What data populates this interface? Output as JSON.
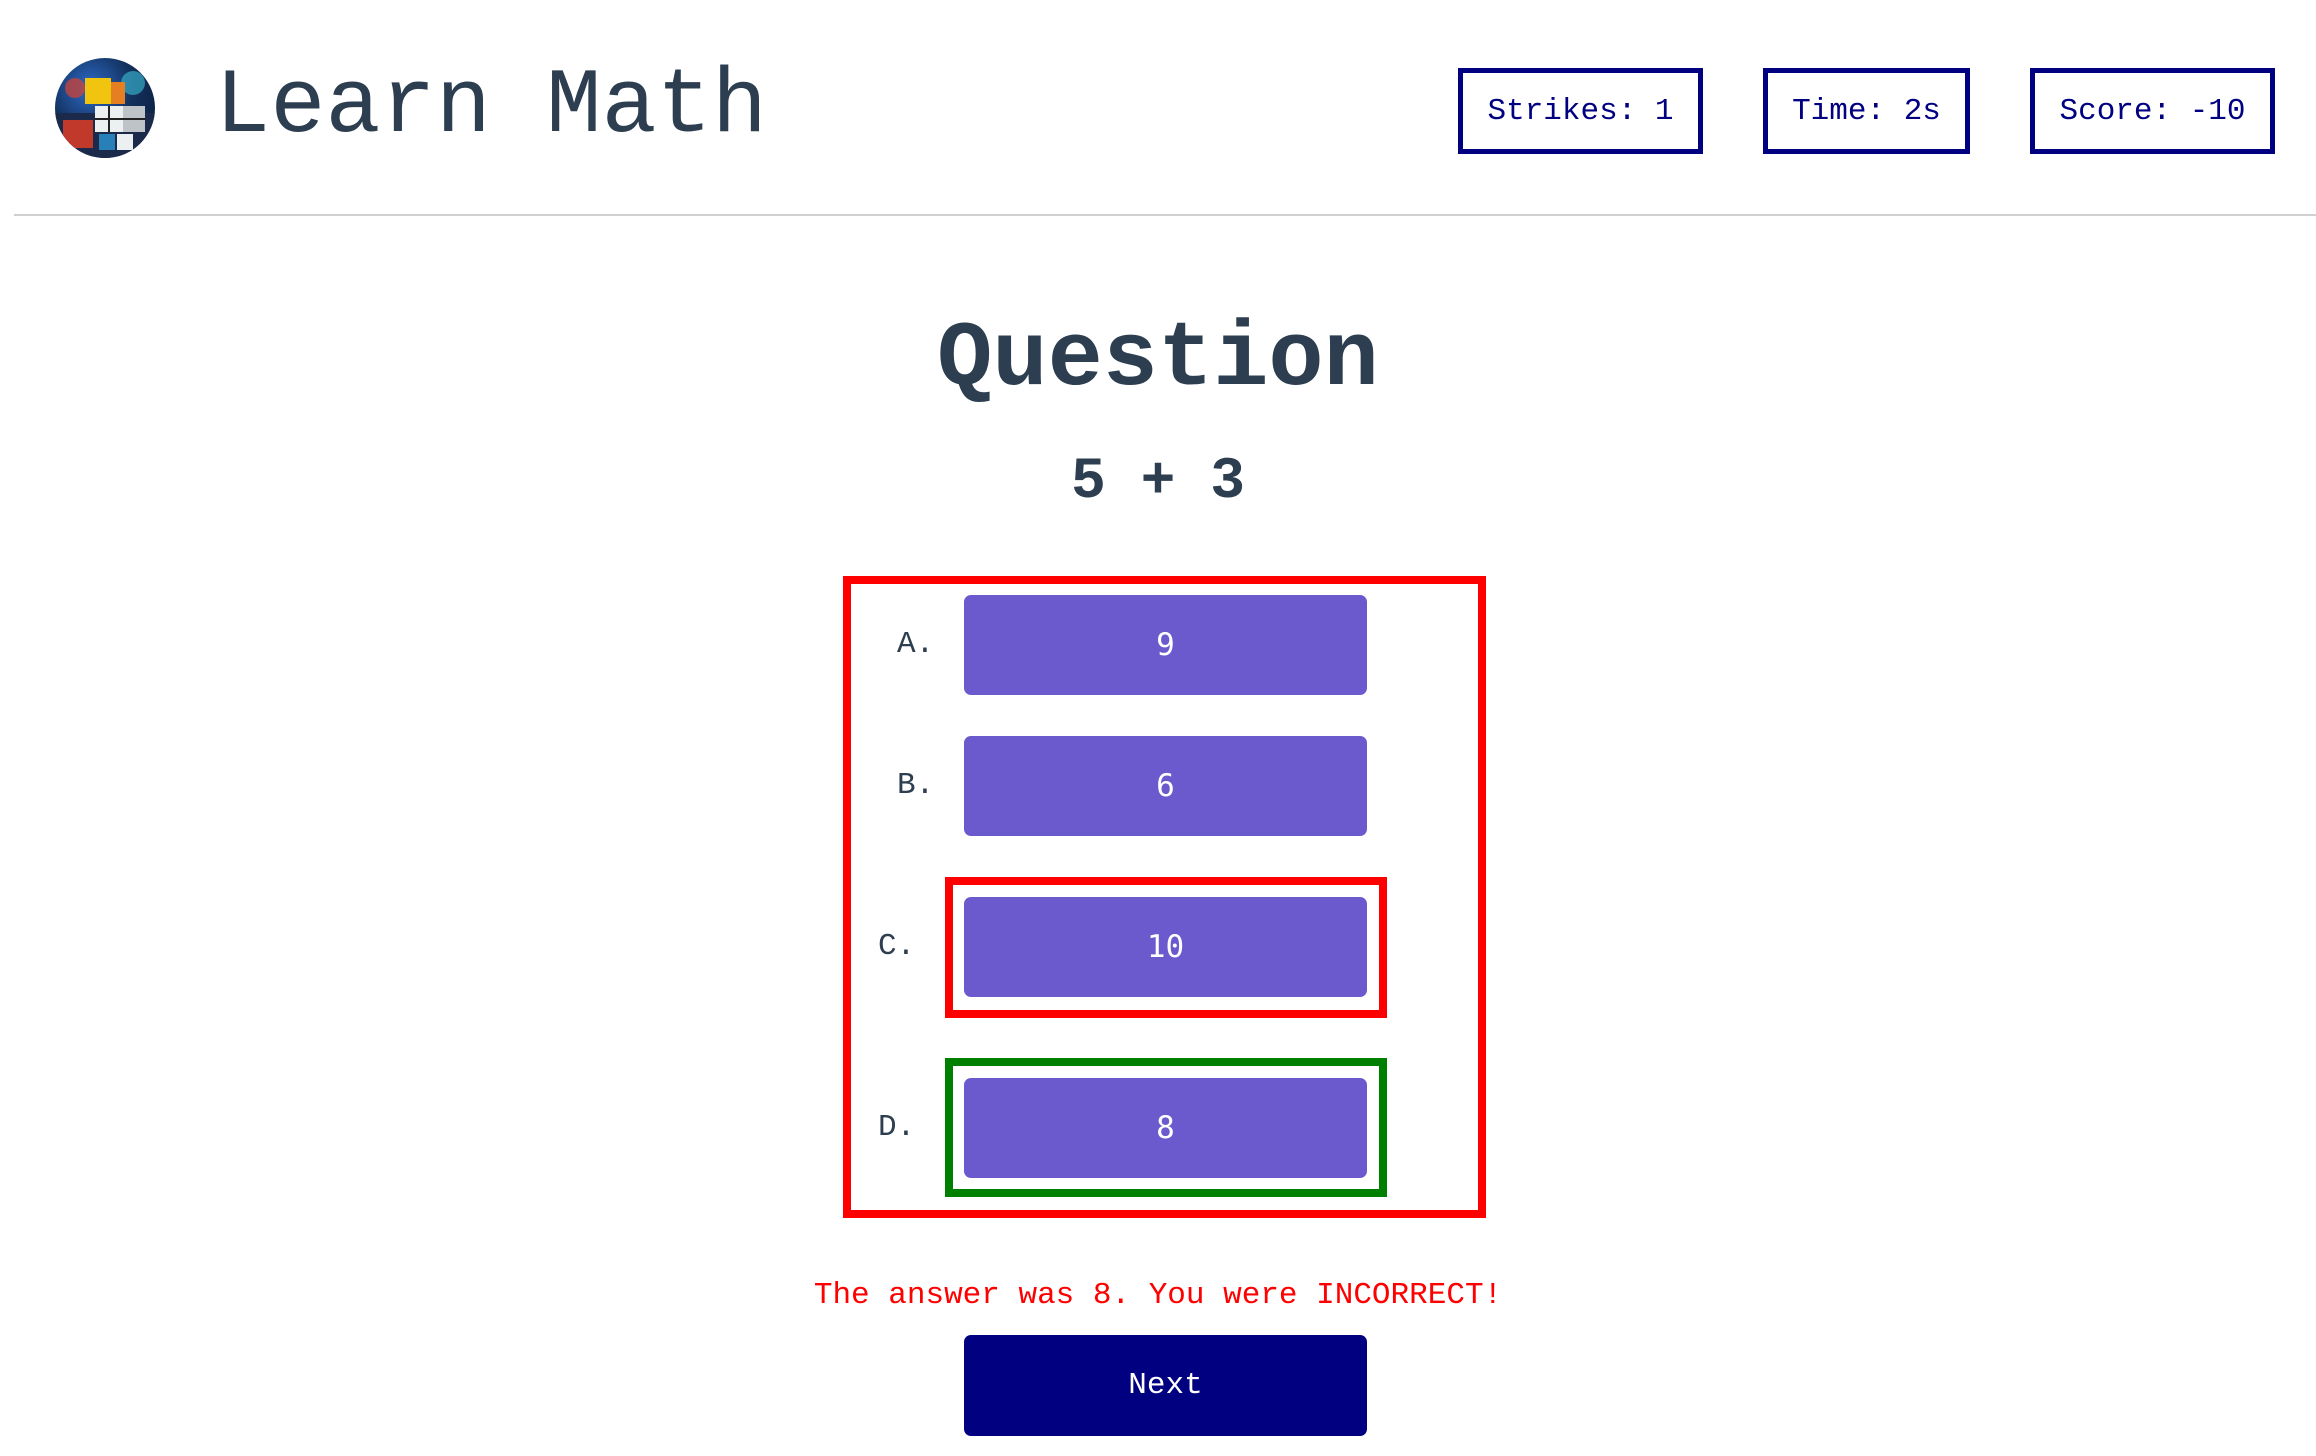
{
  "header": {
    "title": "Learn Math",
    "logo_icon": "rubiks-cube-avatar-icon",
    "stats": {
      "strikes": "Strikes: 1",
      "time": "Time: 2s",
      "score": "Score: -10"
    }
  },
  "question": {
    "heading": "Question",
    "expression": "5 + 3"
  },
  "choices": [
    {
      "letter": "A.",
      "value": "9"
    },
    {
      "letter": "B.",
      "value": "6"
    },
    {
      "letter": "C.",
      "value": "10"
    },
    {
      "letter": "D.",
      "value": "8"
    }
  ],
  "feedback": {
    "message": "The answer was 8. You were INCORRECT!",
    "next_label": "Next"
  },
  "colors": {
    "accent_button": "#6a5acd",
    "primary_navy": "#000080",
    "incorrect": "#ff0000",
    "correct": "#008000",
    "text": "#2c3e50"
  }
}
